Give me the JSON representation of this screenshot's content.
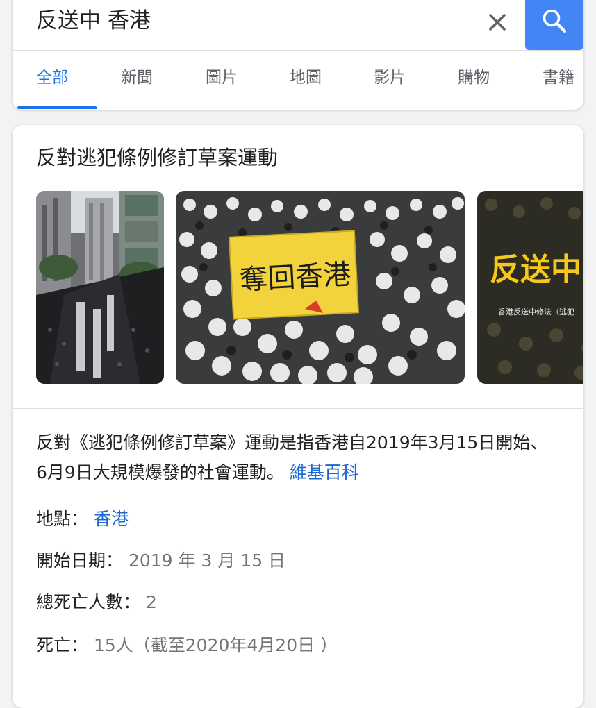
{
  "search": {
    "query": "反送中 香港",
    "clear_icon": "close-icon",
    "search_icon": "search-icon",
    "accent": "#4285f4"
  },
  "tabs": [
    {
      "label": "全部",
      "active": true
    },
    {
      "label": "新聞"
    },
    {
      "label": "圖片"
    },
    {
      "label": "地圖"
    },
    {
      "label": "影片"
    },
    {
      "label": "購物"
    },
    {
      "label": "書籍"
    }
  ],
  "knowledge_panel": {
    "title": "反對逃犯條例修訂草案運動",
    "images": [
      {
        "caption": ""
      },
      {
        "caption": "奪回香港"
      },
      {
        "caption": "反送中",
        "subcaption": "香港反送中修法（逃犯"
      }
    ],
    "description": "反對《逃犯條例修訂草案》運動是指香港自2019年3月15日開始、6月9日大規模爆發的社會運動。",
    "source_link": "維基百科",
    "facts": [
      {
        "label": "地點：",
        "value": "香港"
      },
      {
        "label": "開始日期：",
        "value": "2019 年 3 月 15 日"
      },
      {
        "label": "總死亡人數：",
        "value": "2"
      },
      {
        "label": "死亡：",
        "value": "15人（截至2020年4月20日 ）"
      }
    ]
  },
  "colors": {
    "link": "#1967d2",
    "active_tab": "#1a73e8",
    "banner_yellow": "#f3d33c"
  }
}
